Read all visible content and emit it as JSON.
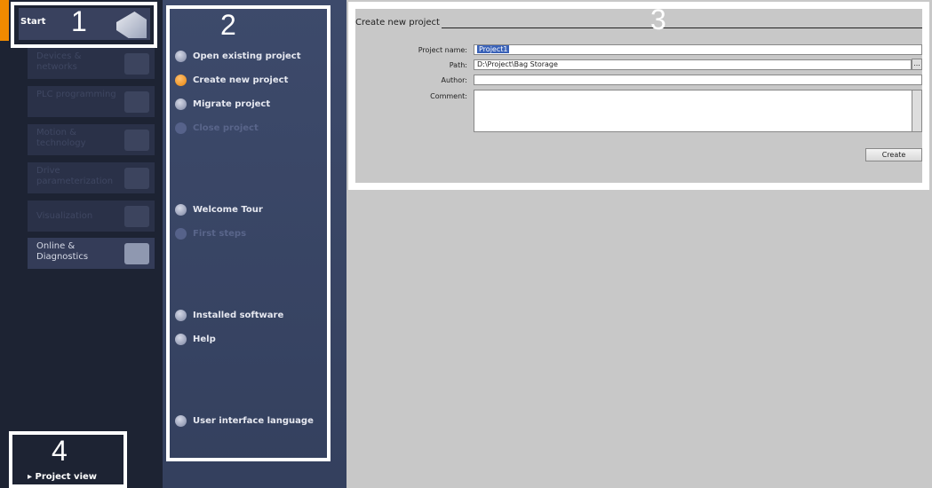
{
  "portal": {
    "start": "Start",
    "tiles": [
      {
        "label": "Devices & networks",
        "enabled": false,
        "icon": "devices-icon"
      },
      {
        "label": "PLC programming",
        "enabled": false,
        "icon": "plc-icon"
      },
      {
        "label": "Motion & technology",
        "enabled": false,
        "icon": "gear-icon"
      },
      {
        "label": "Drive parameterization",
        "enabled": false,
        "icon": "drive-icon"
      },
      {
        "label": "Visualization",
        "enabled": false,
        "icon": "hmi-icon"
      },
      {
        "label": "Online & Diagnostics",
        "enabled": true,
        "icon": "screwdriver-icon"
      }
    ],
    "project_view": "Project view"
  },
  "menu": {
    "items": [
      {
        "label": "Open existing project",
        "enabled": true
      },
      {
        "label": "Create new project",
        "enabled": true,
        "selected": true
      },
      {
        "label": "Migrate project",
        "enabled": true
      },
      {
        "label": "Close project",
        "enabled": false
      },
      {
        "label": "Welcome Tour",
        "enabled": true
      },
      {
        "label": "First steps",
        "enabled": false
      },
      {
        "label": "Installed software",
        "enabled": true
      },
      {
        "label": "Help",
        "enabled": true
      },
      {
        "label": "User interface language",
        "enabled": true
      }
    ]
  },
  "form": {
    "title": "Create new project",
    "project_name_label": "Project name:",
    "project_name": "Project1",
    "path_label": "Path:",
    "path": "D:\\Project\\Bag Storage",
    "browse": "...",
    "author_label": "Author:",
    "author": "",
    "comment_label": "Comment:",
    "comment": "",
    "create": "Create"
  },
  "annotations": [
    "1",
    "2",
    "3",
    "4"
  ],
  "colors": {
    "accent": "#f08a00",
    "selection": "#3a62b8"
  }
}
